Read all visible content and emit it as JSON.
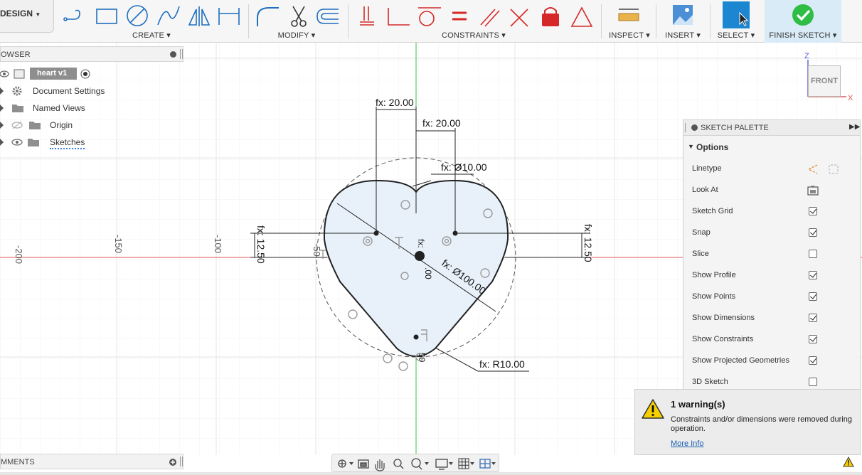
{
  "toolbar": {
    "workspace": "DESIGN",
    "groups": {
      "create": "CREATE",
      "modify": "MODIFY",
      "constraints": "CONSTRAINTS",
      "inspect": "INSPECT",
      "insert": "INSERT",
      "select": "SELECT",
      "finish": "FINISH SKETCH"
    }
  },
  "browser": {
    "title": "OWSER",
    "items": [
      {
        "label": "heart v1"
      },
      {
        "label": "Document Settings"
      },
      {
        "label": "Named Views"
      },
      {
        "label": "Origin"
      },
      {
        "label": "Sketches"
      }
    ]
  },
  "comments": {
    "title": "MMENTS"
  },
  "canvas": {
    "axis_ticks": [
      "-200",
      "-150",
      "-100",
      "-50"
    ],
    "dimensions": {
      "d1": "fx: 20.00",
      "d2": "fx: 20.00",
      "d3": "fx: Ø10.00",
      "d4": "fx: 12.50",
      "d5": "fx: 12.50",
      "d6": "fx: Ø100.00",
      "d7": "fx: R10.00",
      "d8": "fx:",
      "d9": ".00",
      "d10": "50"
    },
    "viewcube": {
      "face": "FRONT",
      "z": "Z",
      "x": "X"
    }
  },
  "sketch_palette": {
    "title": "SKETCH PALETTE",
    "section": "Options",
    "rows": [
      {
        "label": "Linetype",
        "type": "icons"
      },
      {
        "label": "Look At",
        "type": "icon"
      },
      {
        "label": "Sketch Grid",
        "checked": true
      },
      {
        "label": "Snap",
        "checked": true
      },
      {
        "label": "Slice",
        "checked": false
      },
      {
        "label": "Show Profile",
        "checked": true
      },
      {
        "label": "Show Points",
        "checked": true
      },
      {
        "label": "Show Dimensions",
        "checked": true
      },
      {
        "label": "Show Constraints",
        "checked": true
      },
      {
        "label": "Show Projected Geometries",
        "checked": true
      },
      {
        "label": "3D Sketch",
        "checked": false
      }
    ]
  },
  "warning": {
    "title": "1 warning(s)",
    "message": "Constraints and/or dimensions were removed during operation.",
    "link": "More Info"
  },
  "colors": {
    "accent": "#1d86d1",
    "finish_bg": "#d9ebf7",
    "finish_check": "#2ebd45",
    "axis_x": "#e05a5a",
    "axis_y": "#3bbf4a",
    "profile_fill": "#e8f1fa",
    "constraint_red": "#d62828"
  }
}
